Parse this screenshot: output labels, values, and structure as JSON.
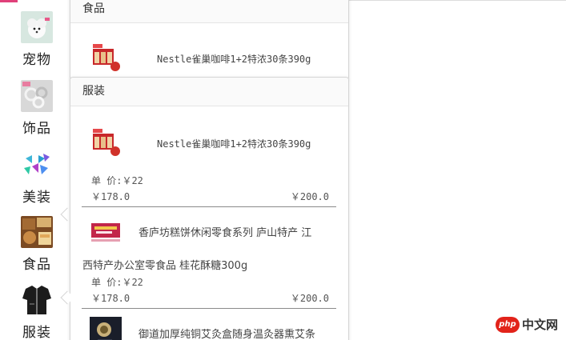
{
  "nav": {
    "categories": [
      {
        "label": "宠物",
        "icon": "pet-dog-thumbnail"
      },
      {
        "label": "饰品",
        "icon": "jewelry-rings-thumbnail"
      },
      {
        "label": "美装",
        "icon": "butterfly-bows-thumbnail"
      },
      {
        "label": "食品",
        "icon": "snack-food-thumbnail"
      },
      {
        "label": "服装",
        "icon": "black-jacket-thumbnail"
      }
    ]
  },
  "food_panel": {
    "title": "食品",
    "item": {
      "name": "Nestle雀巢咖啡1+2特浓30条390g"
    }
  },
  "clothing_panel": {
    "title": "服装",
    "items": [
      {
        "name": "Nestle雀巢咖啡1+2特浓30条390g",
        "unit_price": "单  价:￥22",
        "price_left": "￥178.0",
        "price_right": "￥200.0"
      },
      {
        "name_line1": "香庐坊糕饼休闲零食系列 庐山特产 江",
        "name_line2": "西特产办公室零食品 桂花酥糖300g",
        "unit_price": "单  价:￥22",
        "price_left": "￥178.0",
        "price_right": "￥200.0"
      },
      {
        "name": "御道加厚纯铜艾灸盒随身温灸器熏艾条"
      }
    ]
  },
  "watermark": {
    "logo": "php",
    "text": "中文网"
  },
  "colors": {
    "accent": "#e0407a",
    "watermark": "#e2231a"
  }
}
